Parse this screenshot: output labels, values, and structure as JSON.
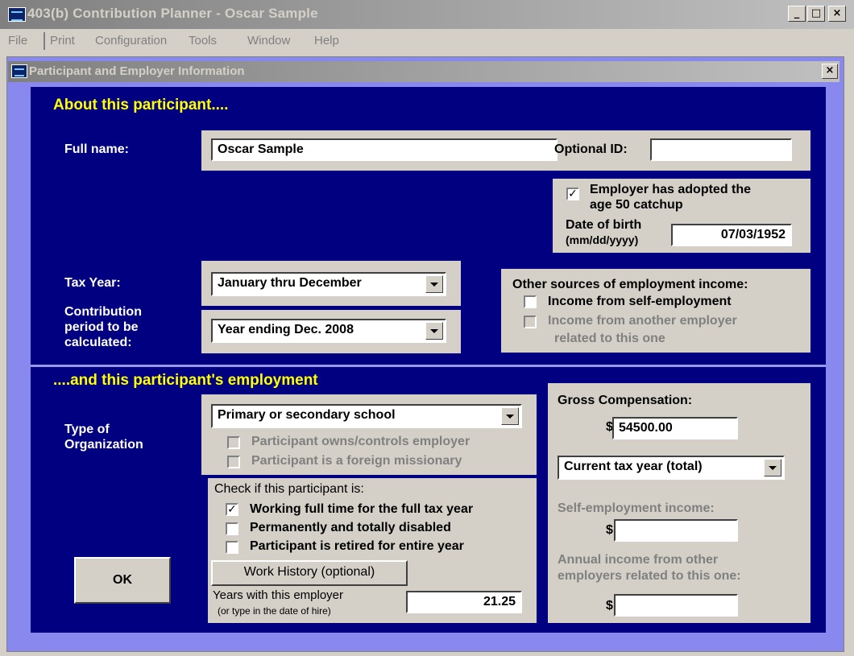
{
  "window": {
    "title": "403(b) Contribution Planner - Oscar Sample",
    "minimize": "_",
    "maximize": "□",
    "close": "×"
  },
  "menu": [
    "File",
    "Print",
    "Configuration",
    "Tools",
    "Window",
    "Help"
  ],
  "dialog": {
    "title": "Participant and Employer Information",
    "close": "×"
  },
  "participant": {
    "heading": "About this participant....",
    "full_name_label": "Full name:",
    "full_name": "Oscar Sample",
    "optional_id_label": "Optional ID:",
    "optional_id": "",
    "catchup_label_1": "Employer has adopted the",
    "catchup_label_2": "age 50 catchup",
    "catchup_checked": "✓",
    "dob_label_1": "Date of birth",
    "dob_label_2": "(mm/dd/yyyy)",
    "dob": "07/03/1952",
    "tax_year_label": "Tax Year:",
    "tax_year": "January thru December",
    "period_label_1": "Contribution",
    "period_label_2": "period to be",
    "period_label_3": "calculated:",
    "period": "Year ending Dec. 2008",
    "other_income_label": "Other sources of employment income:",
    "self_employment_label": "Income from self-employment",
    "related_employer_label_1": "Income from another employer",
    "related_employer_label_2": "related to this one"
  },
  "employment": {
    "heading": "....and this participant's employment",
    "org_type_label_1": "Type of",
    "org_type_label_2": "Organization",
    "org_type": "Primary or secondary school",
    "owns_label": "Participant owns/controls employer",
    "missionary_label": "Participant is a foreign missionary",
    "check_if_label": "Check if this participant is:",
    "full_time_label": "Working full time for the full tax year",
    "full_time_checked": "✓",
    "disabled_label": "Permanently and totally disabled",
    "retired_label": "Participant is retired for entire year",
    "work_history_button": "Work History (optional)",
    "years_label_1": "Years with this employer",
    "years_label_2": "(or type in the date of hire)",
    "years": "21.25",
    "ok_button": "OK",
    "gross_comp_label": "Gross Compensation:",
    "currency": "$",
    "gross_comp": "54500.00",
    "comp_period": "Current tax year (total)",
    "self_emp_income_label": "Self-employment income:",
    "self_emp_income": "",
    "annual_income_label_1": "Annual income from other",
    "annual_income_label_2": "employers related to this one:",
    "annual_income": ""
  }
}
